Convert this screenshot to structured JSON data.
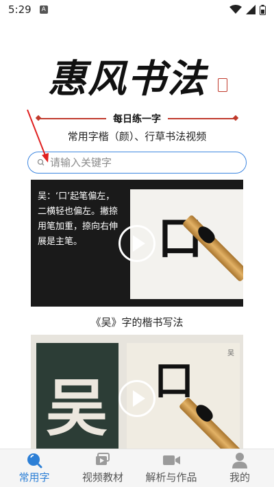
{
  "status_bar": {
    "time": "5:29",
    "notification": "A"
  },
  "logo": {
    "title": "惠风书法"
  },
  "header": {
    "slogan": "每日练一字",
    "subtitle": "常用字楷（颜）、行草书法视频"
  },
  "search": {
    "placeholder": "请输入关键字",
    "value": ""
  },
  "videos": [
    {
      "title": "《吴》字的楷书写法",
      "caption": "吴：‘口’起笔偏左，二横轻也偏左。撇捺用笔加重，捺向右伸展是主笔。",
      "stroke": "口"
    },
    {
      "title": "",
      "corner_mark": "吴",
      "rubbing_char": "吴",
      "stroke": "口"
    }
  ],
  "tabs": [
    {
      "label": "常用字",
      "icon": "search-icon",
      "active": true
    },
    {
      "label": "视频教材",
      "icon": "video-library-icon",
      "active": false
    },
    {
      "label": "解析与作品",
      "icon": "video-camera-icon",
      "active": false
    },
    {
      "label": "我的",
      "icon": "user-icon",
      "active": false
    }
  ],
  "colors": {
    "accent": "#2c7fd6",
    "search_border": "#3d86e0",
    "brand_red": "#c0392b"
  }
}
